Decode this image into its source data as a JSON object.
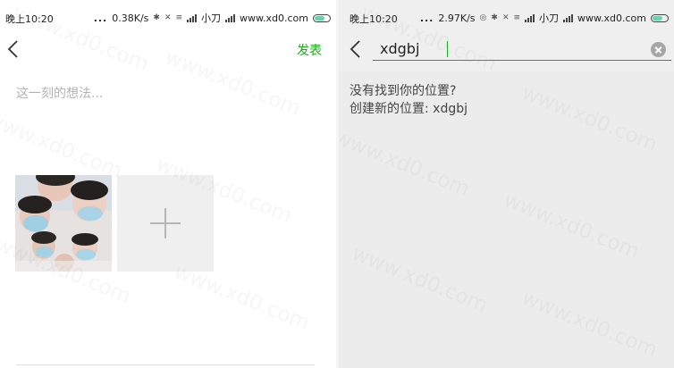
{
  "left": {
    "status": {
      "time": "晚上10:20",
      "dots": "...",
      "speed": "0.38K/s",
      "carrier": "小刀",
      "site": "www.xd0.com"
    },
    "post_label": "发表",
    "thought_placeholder": "这一刻的想法..."
  },
  "right": {
    "status": {
      "time": "晚上10:20",
      "dots": "...",
      "speed": "2.97K/s",
      "carrier": "小刀",
      "site": "www.xd0.com"
    },
    "search_value": "xdgbj",
    "no_result_line": "没有找到你的位置?",
    "create_line": "创建新的位置: xdgbj"
  },
  "watermark": "www.xd0.com",
  "colors": {
    "accent": "#1aad19",
    "placeholder": "#b3b3b3",
    "battery": "#6cd1a8"
  },
  "icons": [
    "back-arrow-icon",
    "add-photo-icon",
    "clear-icon",
    "bluetooth-icon",
    "mute-icon",
    "signal-icon",
    "battery-icon"
  ]
}
